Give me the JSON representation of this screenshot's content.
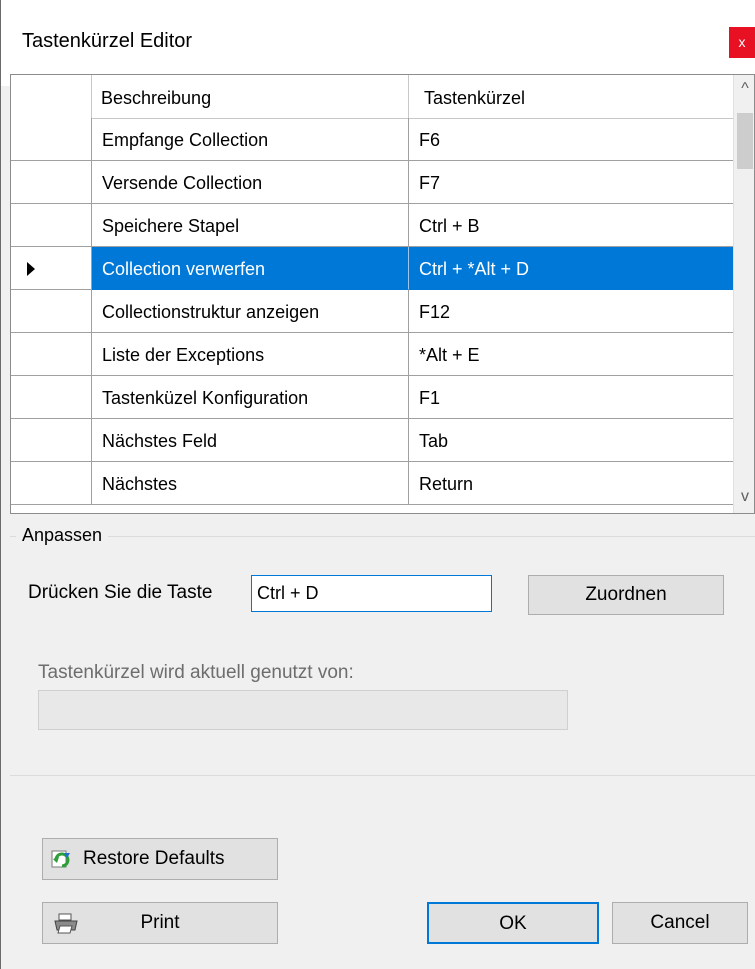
{
  "window": {
    "title": "Tastenkürzel Editor",
    "close_label": "x"
  },
  "grid": {
    "columns": [
      "Beschreibung",
      "Tastenkürzel"
    ],
    "rows": [
      {
        "description": "Empfange Collection",
        "shortcut": "F6"
      },
      {
        "description": "Versende Collection",
        "shortcut": "F7"
      },
      {
        "description": "Speichere Stapel",
        "shortcut": "Ctrl + B"
      },
      {
        "description": "Collection verwerfen",
        "shortcut": "Ctrl + *Alt + D"
      },
      {
        "description": "Collectionstruktur anzeigen",
        "shortcut": "F12"
      },
      {
        "description": "Liste der Exceptions",
        "shortcut": "*Alt + E"
      },
      {
        "description": "Tastenküzel Konfiguration",
        "shortcut": "F1"
      },
      {
        "description": "Nächstes Feld",
        "shortcut": "Tab"
      },
      {
        "description": "Nächstes",
        "shortcut": "Return"
      }
    ],
    "selected_row": 3,
    "scroll_up": "^",
    "scroll_down": "v"
  },
  "customize": {
    "group_label": "Anpassen",
    "press_label": "Drücken Sie die Taste",
    "key_value": "Ctrl + D",
    "assign_button": "Zuordnen",
    "usage_label": "Tastenkürzel wird aktuell genutzt von:",
    "usage_value": ""
  },
  "buttons": {
    "restore_defaults": "Restore Defaults",
    "print": "Print",
    "ok": "OK",
    "cancel": "Cancel"
  },
  "icons": {
    "restore": "restore-icon",
    "print": "printer-icon"
  },
  "colors": {
    "selection": "#0078d7",
    "close": "#e81123"
  }
}
